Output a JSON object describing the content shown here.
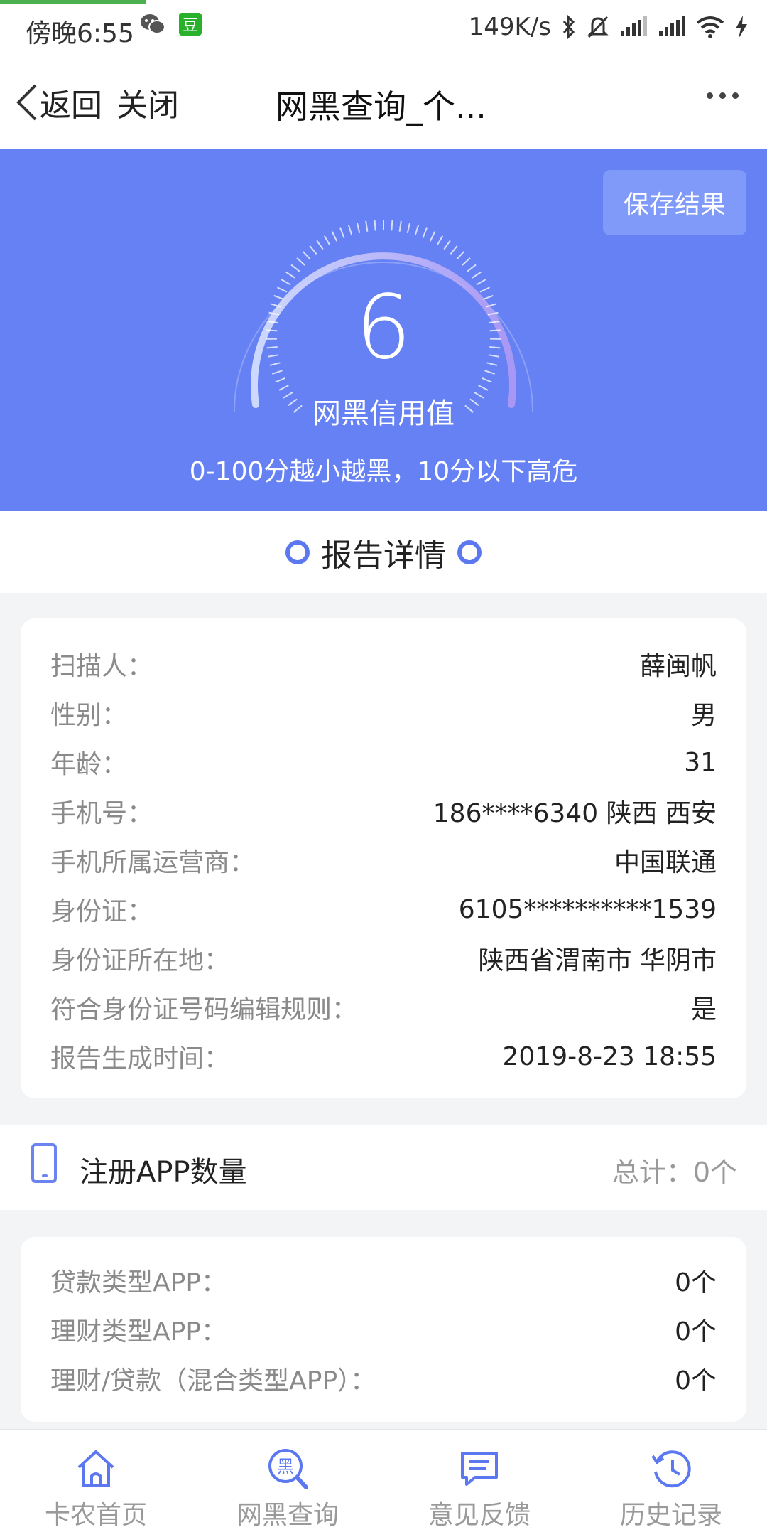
{
  "status": {
    "time": "傍晚6:55",
    "douban": "豆",
    "speed": "149K/s"
  },
  "nav": {
    "back": "返回",
    "close": "关闭",
    "title": "网黑查询_个..."
  },
  "hero": {
    "save": "保存结果",
    "score": "6",
    "score_label": "网黑信用值",
    "hint": "0-100分越小越黑，10分以下高危",
    "colors": {
      "background": "#6581f3",
      "button": "#7f9af8"
    }
  },
  "report": {
    "title": "报告详情",
    "rows": [
      {
        "label": "扫描人：",
        "value": "薛闽帆"
      },
      {
        "label": "性别：",
        "value": "男"
      },
      {
        "label": "年龄：",
        "value": "31"
      },
      {
        "label": "手机号：",
        "value": "186****6340 陕西 西安"
      },
      {
        "label": "手机所属运营商：",
        "value": "中国联通"
      },
      {
        "label": "身份证：",
        "value": "6105**********1539"
      },
      {
        "label": "身份证所在地：",
        "value": "陕西省渭南市 华阴市"
      },
      {
        "label": "符合身份证号码编辑规则：",
        "value": "是"
      },
      {
        "label": "报告生成时间：",
        "value": "2019-8-23 18:55"
      }
    ]
  },
  "apps": {
    "title": "注册APP数量",
    "total": "总计：0个",
    "rows": [
      {
        "label": "贷款类型APP：",
        "value": "0个"
      },
      {
        "label": "理财类型APP：",
        "value": "0个"
      },
      {
        "label": "理财/贷款（混合类型APP）：",
        "value": "0个"
      }
    ]
  },
  "tabs": [
    {
      "label": "卡农首页",
      "icon": "home-icon"
    },
    {
      "label": "网黑查询",
      "icon": "blacklist-search-icon",
      "glyph": "黑"
    },
    {
      "label": "意见反馈",
      "icon": "feedback-icon"
    },
    {
      "label": "历史记录",
      "icon": "history-icon"
    }
  ]
}
